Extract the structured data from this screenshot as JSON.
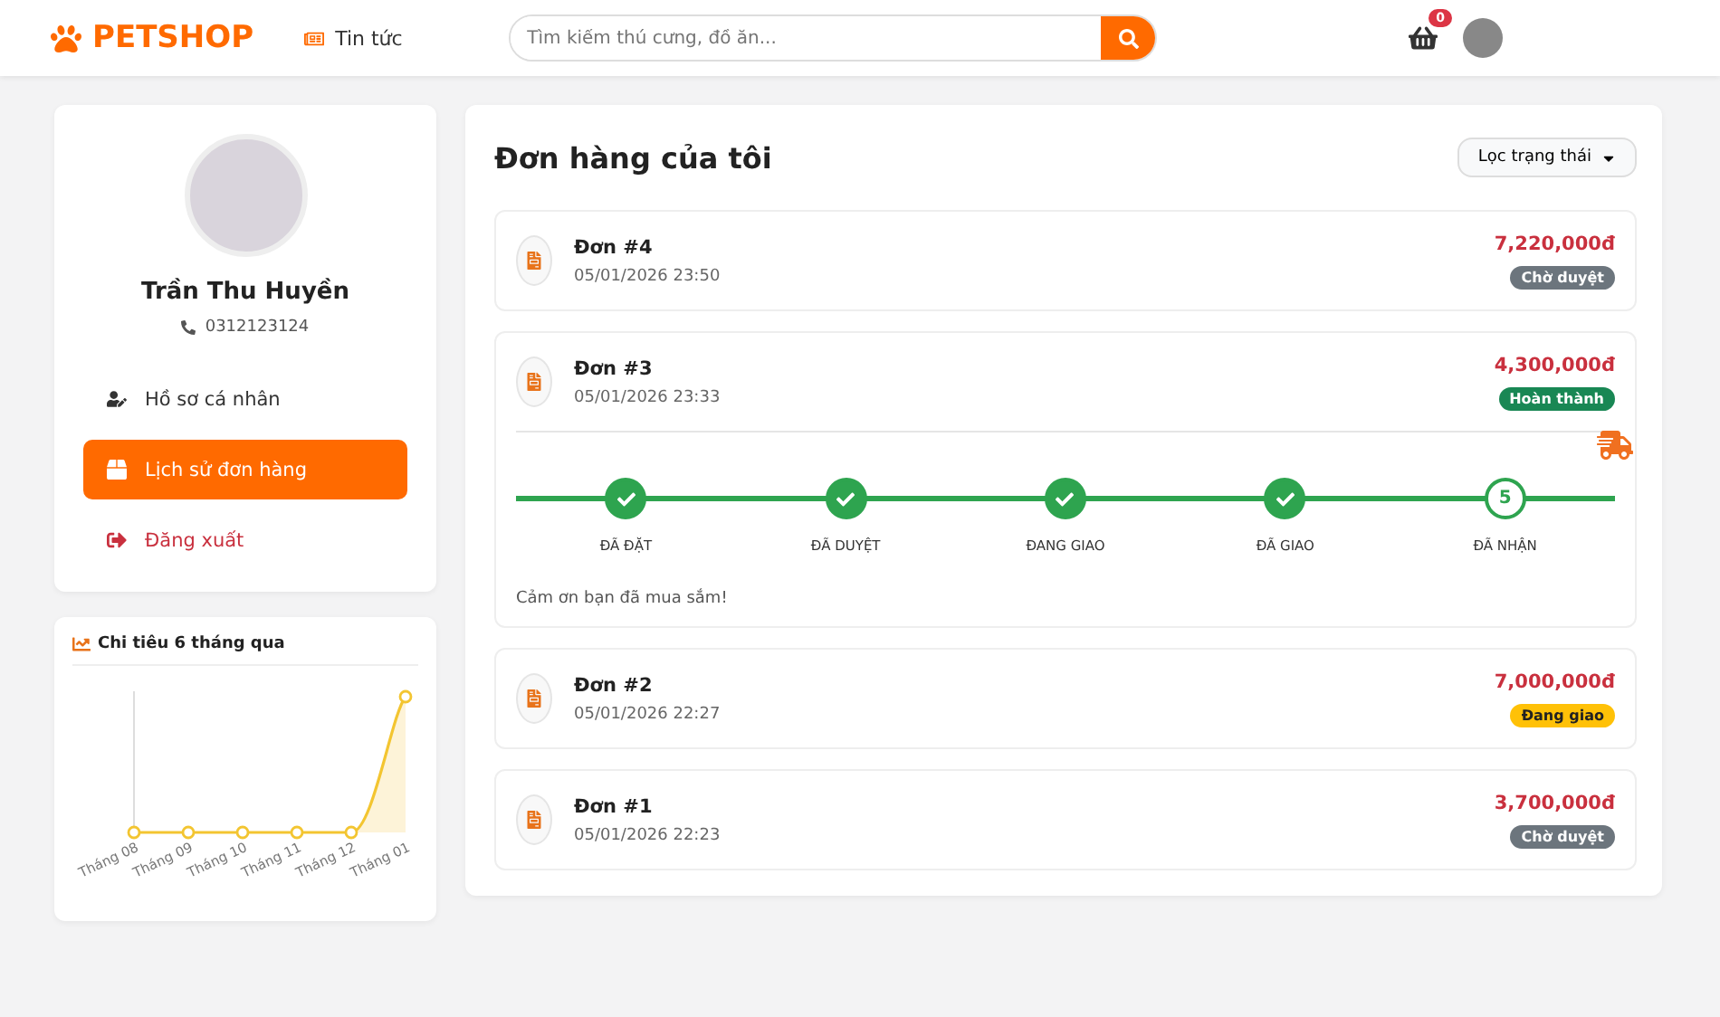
{
  "header": {
    "brand": "PETSHOP",
    "nav_link": "Tin tức",
    "search": {
      "placeholder": "Tìm kiếm thú cưng, đồ ăn..."
    },
    "cart_count": "0"
  },
  "profile": {
    "name": "Trần Thu Huyền",
    "phone": "0312123124",
    "menu": [
      {
        "kind": "profile",
        "label": "Hồ sơ cá nhân",
        "selected": false
      },
      {
        "kind": "orders",
        "label": "Lịch sử đơn hàng",
        "selected": true
      },
      {
        "kind": "logout",
        "label": "Đăng xuất",
        "selected": false
      }
    ]
  },
  "spending": {
    "title": "Chi tiêu 6 tháng qua",
    "month_labels": [
      "Tháng 08",
      "Tháng 09",
      "Tháng 10",
      "Tháng 11",
      "Tháng 12",
      "Tháng 01"
    ]
  },
  "orders": {
    "title": "Đơn hàng của tôi",
    "filter": "Lọc trạng thái",
    "items": [
      {
        "name": "Đơn #4",
        "date": "05/01/2026 23:50",
        "total": "7,220,000đ",
        "status": "Chờ duyệt",
        "color": "#6c757d"
      },
      {
        "name": "Đơn #3",
        "date": "05/01/2026 23:33",
        "total": "4,300,000đ",
        "status": "Hoàn thành",
        "color": "#198754",
        "steps": [
          {
            "label": "ĐÃ ĐẶT",
            "done": true
          },
          {
            "label": "ĐÃ DUYỆT",
            "done": true
          },
          {
            "label": "ĐANG GIAO",
            "done": true
          },
          {
            "label": "ĐÃ GIAO",
            "done": true
          },
          {
            "label": "ĐÃ NHẬN",
            "done": false,
            "number": "5"
          }
        ],
        "note": "Cảm ơn bạn đã mua sắm!"
      },
      {
        "name": "Đơn #2",
        "date": "05/01/2026 22:27",
        "total": "7,000,000đ",
        "status": "Đang giao",
        "color": "#ffc107"
      },
      {
        "name": "Đơn #1",
        "date": "05/01/2026 22:23",
        "total": "3,700,000đ",
        "status": "Chờ duyệt",
        "color": "#6c757d"
      }
    ]
  }
}
